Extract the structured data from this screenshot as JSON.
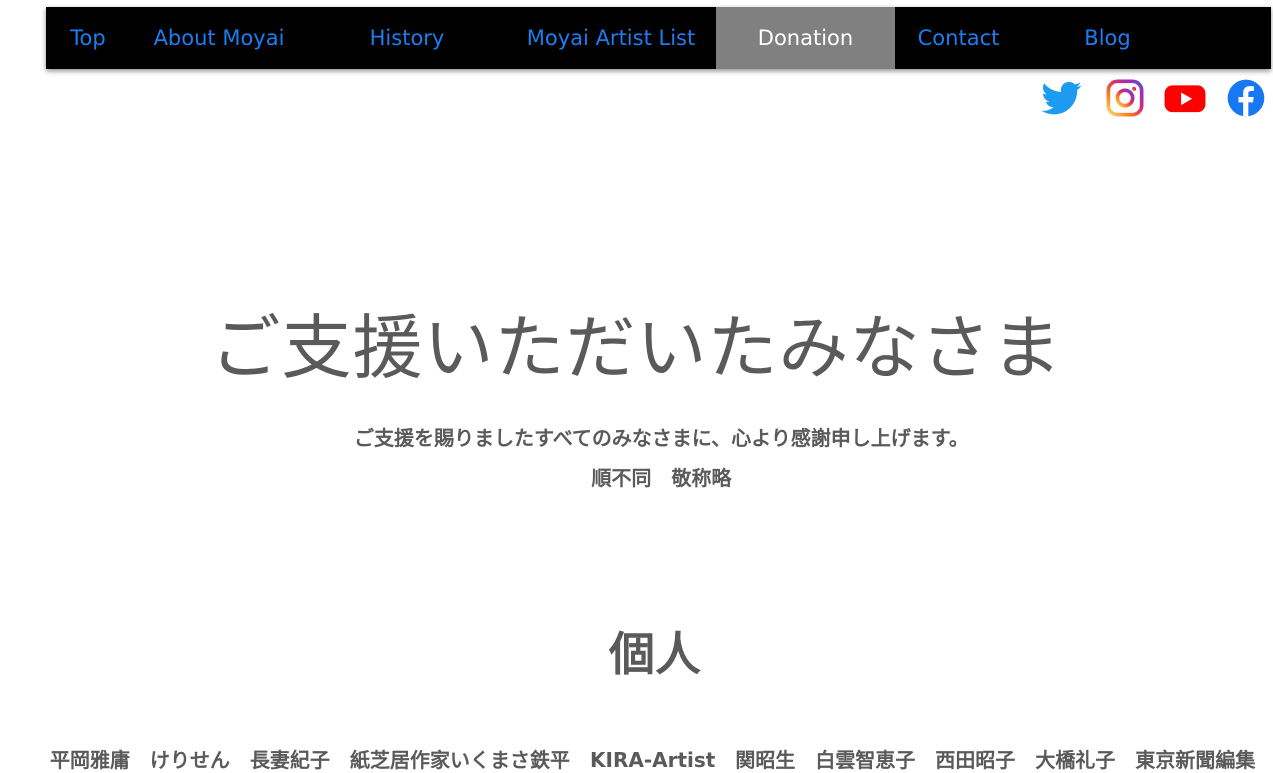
{
  "nav": {
    "items": [
      {
        "label": "Top",
        "active": false
      },
      {
        "label": "About Moyai",
        "active": false
      },
      {
        "label": "History",
        "active": false
      },
      {
        "label": "Moyai Artist List",
        "active": false
      },
      {
        "label": "Donation",
        "active": true
      },
      {
        "label": "Contact",
        "active": false
      },
      {
        "label": "Blog",
        "active": false
      }
    ],
    "link_color": "#1a7ef2",
    "active_bg": "#808080"
  },
  "social": {
    "icons": [
      "twitter-icon",
      "instagram-icon",
      "youtube-icon",
      "facebook-icon"
    ]
  },
  "hero": {
    "title": "ご支援いただいたみなさま",
    "subtitle": "ご支援を賜りましたすべてのみなさまに、心より感謝申し上げます。",
    "note": "順不同　敬称略"
  },
  "section": {
    "title": "個人",
    "names_line": "平岡雅庸　けりせん　長妻紀子　紙芝居作家いくまさ鉄平　KIRA-Artist　関昭生　白雲智恵子　西田昭子　大橋礼子　東京新聞編集"
  }
}
